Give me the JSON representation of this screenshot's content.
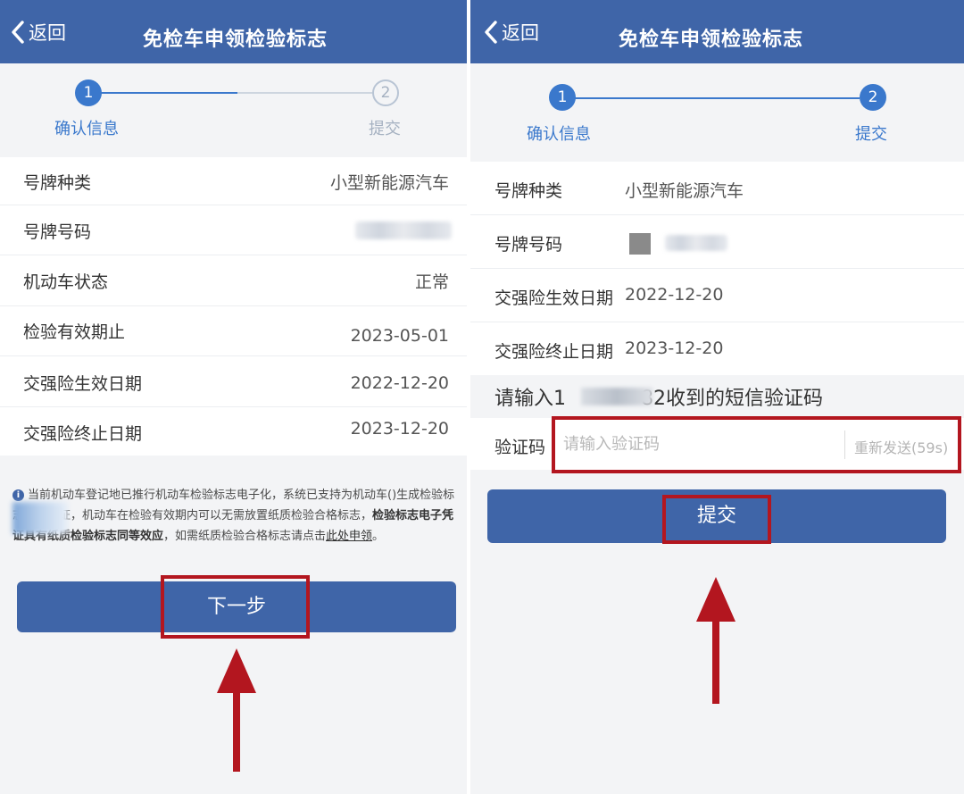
{
  "header": {
    "back_label": "返回",
    "title": "免检车申领检验标志",
    "background": "#3f65a8"
  },
  "steps": [
    {
      "number": "1",
      "label": "确认信息"
    },
    {
      "number": "2",
      "label": "提交"
    }
  ],
  "left": {
    "rows": [
      {
        "label": "号牌种类",
        "value": "小型新能源汽车"
      },
      {
        "label": "号牌号码",
        "value": ""
      },
      {
        "label": "机动车状态",
        "value": "正常"
      },
      {
        "label": "检验有效期止",
        "value": "2023-05-01"
      },
      {
        "label": "交强险生效日期",
        "value": "2022-12-20"
      },
      {
        "label": "交强险终止日期",
        "value": "2023-12-20"
      }
    ],
    "notice": {
      "part1": "当前机动车登记地已推行机动车检验标志电子化，系统已支持为机动车(",
      "part2": ")生成检验标志电子凭证，机动车在检验有效期内可以无需放置",
      "part3": "纸质检验合格标志，",
      "bold": "检验标志电子凭证具有纸质检验标志同等效应",
      "part4": "，如需纸质检验合格标志请点击",
      "link": "此处申领",
      "end": "。"
    },
    "next_button": "下一步"
  },
  "right": {
    "rows": [
      {
        "label": "号牌种类",
        "value": "小型新能源汽车"
      },
      {
        "label": "号牌号码",
        "value": ""
      },
      {
        "label": "交强险生效日期",
        "value": "2022-12-20"
      },
      {
        "label": "交强险终止日期",
        "value": "2023-12-20"
      }
    ],
    "sms_prefix": "请输入1",
    "sms_suffix": "82收到的短信验证码",
    "code_label": "验证码",
    "code_placeholder": "请输入验证码",
    "resend": "重新发送(59s)",
    "submit_button": "提交"
  },
  "colors": {
    "accent": "#3a78cc",
    "button": "#3f65a8",
    "highlight": "#b3161f"
  }
}
